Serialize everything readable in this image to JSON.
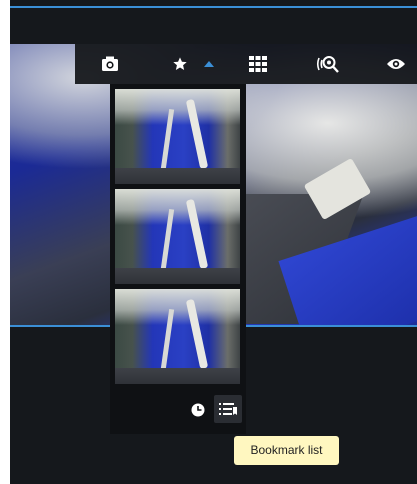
{
  "colors": {
    "app_background": "#15181c",
    "accent_line": "#3b8fd6",
    "toolbar_background": "#121418",
    "icon": "#ffffff",
    "dropdown_indicator": "#3b8fd6",
    "tooltip_background": "#fff7c0",
    "tooltip_text": "#222222"
  },
  "toolbar": {
    "buttons": [
      {
        "name": "snapshot",
        "icon": "camera-icon"
      },
      {
        "name": "bookmark",
        "icon": "star-icon",
        "has_dropdown": true,
        "dropdown_open": true
      },
      {
        "name": "layout",
        "icon": "grid-icon"
      },
      {
        "name": "motion-search",
        "icon": "search-signal-icon"
      },
      {
        "name": "view",
        "icon": "eye-icon"
      }
    ]
  },
  "bookmark_panel": {
    "thumbnails": [
      {
        "content": "camera-frame-1"
      },
      {
        "content": "camera-frame-2"
      },
      {
        "content": "camera-frame-3"
      }
    ],
    "footer": {
      "history_icon": "clock-icon",
      "list_icon": "bookmark-list-icon"
    }
  },
  "tooltip": {
    "text": "Bookmark list"
  }
}
